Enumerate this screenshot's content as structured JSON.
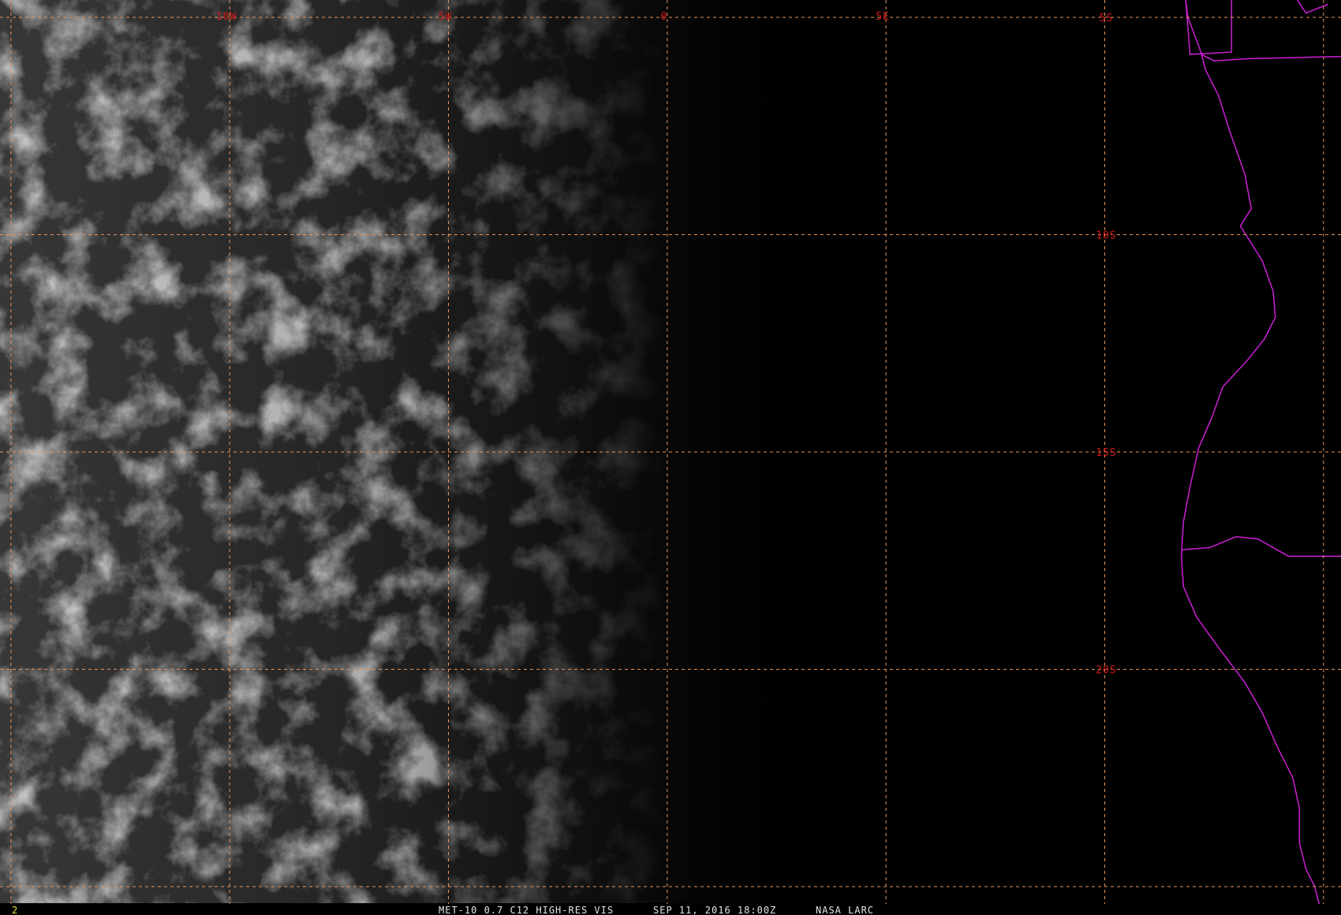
{
  "image": {
    "description_free": true,
    "colors": {
      "background": "#000000",
      "cloud_tone": "#6e6e6e",
      "grid_line": "#e8955a",
      "grid_label": "#d01818",
      "coastline": "#cc1fd6",
      "footer_text": "#e6e6e6",
      "frame_number": "#e8e040"
    }
  },
  "grid": {
    "longitudes": [
      {
        "label": "10W",
        "lon": -10
      },
      {
        "label": "5W",
        "lon": -5
      },
      {
        "label": "0",
        "lon": 0
      },
      {
        "label": "5E",
        "lon": 5
      }
    ],
    "latitudes": [
      {
        "label": "5S",
        "lat": -5
      },
      {
        "label": "10S",
        "lat": -10
      },
      {
        "label": "15S",
        "lat": -15
      },
      {
        "label": "20S",
        "lat": -20
      }
    ],
    "lon_range": [
      -15.25,
      15.4
    ],
    "lat_range": [
      -4.6,
      -25.4
    ]
  },
  "footer": {
    "frame_number": "2",
    "product": "MET-10 0.7 C12 HIGH-RES VIS",
    "datetime": "SEP 11, 2016 18:00Z",
    "source": "NASA LARC"
  }
}
